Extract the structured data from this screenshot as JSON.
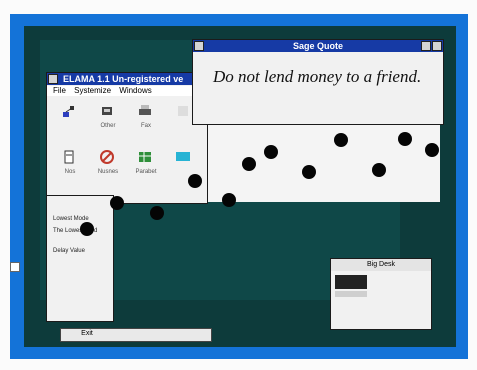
{
  "sage_window": {
    "title": "Sage Quote",
    "quote": "Do not lend money to a friend."
  },
  "elama_window": {
    "title": "ELAMA 1.1 Un-registered ve",
    "menu": [
      "File",
      "Systemize",
      "Windows"
    ],
    "icons": [
      {
        "label": "",
        "icon": "network-icon"
      },
      {
        "label": "Other",
        "icon": "tool-icon"
      },
      {
        "label": "Fax",
        "icon": "printer-icon"
      },
      {
        "label": "",
        "icon": "blank-icon"
      },
      {
        "label": "Nos",
        "icon": "doc-icon"
      },
      {
        "label": "Nusnes",
        "icon": "no-entry-icon"
      },
      {
        "label": "Parabet",
        "icon": "spreadsheet-icon"
      },
      {
        "label": "",
        "icon": "screen-icon"
      }
    ]
  },
  "side_panel": {
    "line1": "Lowest Mode",
    "line2": "The Lowest Mod",
    "line3": "Delay Value"
  },
  "big_desk": {
    "title": "Big Desk"
  },
  "taskbar": {
    "ok_label": "Exit"
  },
  "colors": {
    "bezel": "#1473d8",
    "titlebar": "#163aa5",
    "desktop": "#0d3b3b"
  }
}
